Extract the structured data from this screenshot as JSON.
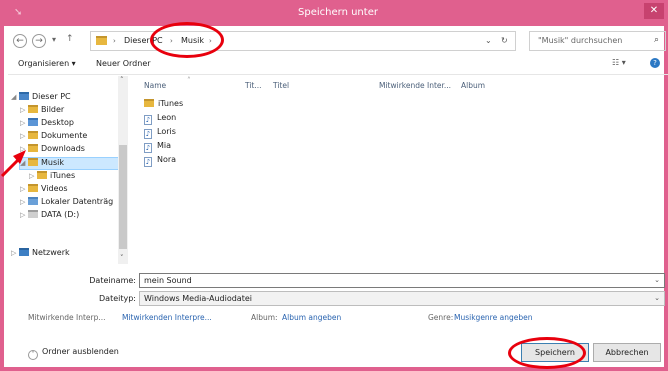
{
  "window": {
    "title": "Speichern unter",
    "close_icon": "✕",
    "accent": "#e0608e"
  },
  "address": {
    "path": [
      "Dieser PC",
      "Musik"
    ],
    "dropdown": "⌄",
    "refresh": "↻"
  },
  "search": {
    "placeholder": "\"Musik\" durchsuchen"
  },
  "toolbar": {
    "organize": "Organisieren ▾",
    "new_folder": "Neuer Ordner",
    "view": "☷ ▾",
    "help": "?"
  },
  "nav": {
    "items": [
      {
        "label": "Dieser PC",
        "arrow": "◢"
      },
      {
        "label": "Bilder",
        "arrow": "▷"
      },
      {
        "label": "Desktop",
        "arrow": "▷"
      },
      {
        "label": "Dokumente",
        "arrow": "▷"
      },
      {
        "label": "Downloads",
        "arrow": "▷"
      },
      {
        "label": "Musik",
        "arrow": "◢"
      },
      {
        "label": "iTunes",
        "arrow": "▷"
      },
      {
        "label": "Videos",
        "arrow": "▷"
      },
      {
        "label": "Lokaler Datenträg",
        "arrow": "▷"
      },
      {
        "label": "DATA (D:)",
        "arrow": "▷"
      },
      {
        "label": "Netzwerk",
        "arrow": "▷"
      }
    ]
  },
  "columns": {
    "name": "Name",
    "num": "Tit...",
    "title": "Titel",
    "artists": "Mitwirkende Inter...",
    "album": "Album"
  },
  "files": [
    {
      "name": "iTunes",
      "type": "folder"
    },
    {
      "name": "Leon",
      "type": "music"
    },
    {
      "name": "Loris",
      "type": "music"
    },
    {
      "name": "Mia",
      "type": "music"
    },
    {
      "name": "Nora",
      "type": "music"
    }
  ],
  "filename": {
    "label": "Dateiname:",
    "value": "mein Sound"
  },
  "filetype": {
    "label": "Dateityp:",
    "value": "Windows Media-Audiodatei"
  },
  "meta": {
    "artists_label": "Mitwirkende Interp...",
    "artists_value": "Mitwirkenden Interpre...",
    "album_label": "Album:",
    "album_value": "Album angeben",
    "genre_label": "Genre:",
    "genre_value": "Musikgenre angeben"
  },
  "buttons": {
    "hide_folders": "Ordner ausblenden",
    "save": "Speichern",
    "cancel": "Abbrechen"
  }
}
